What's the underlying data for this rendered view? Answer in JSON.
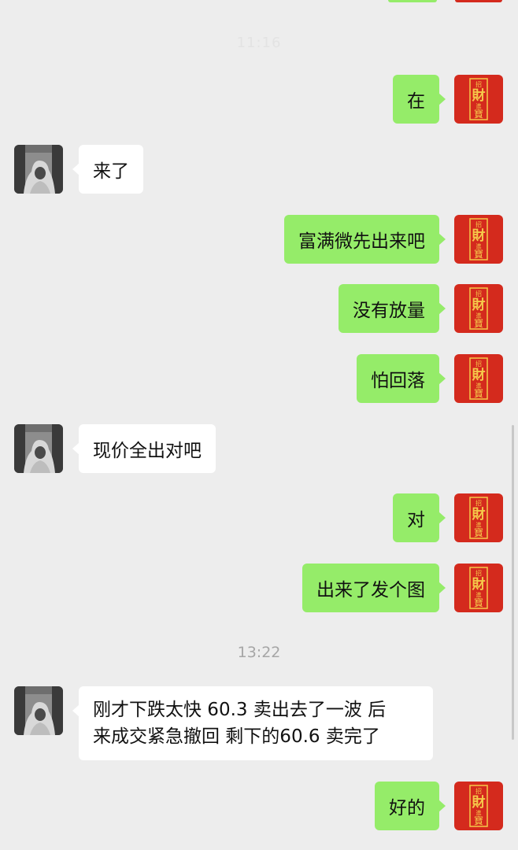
{
  "top_partial": {
    "faded_time": "11:16"
  },
  "divider": {
    "time": "13:22"
  },
  "colors": {
    "background": "#ededed",
    "outgoing_bubble": "#95ec69",
    "incoming_bubble": "#ffffff",
    "my_avatar_red": "#d42a1d",
    "my_avatar_gold": "#f5c94a"
  },
  "avatars": {
    "me_glyphs": [
      "招",
      "財",
      "進",
      "寶"
    ],
    "them_icon": "hooded-figure-icon"
  },
  "messages": [
    {
      "sender": "me",
      "text": "在"
    },
    {
      "sender": "them",
      "text": "来了"
    },
    {
      "sender": "me",
      "text": "富满微先出来吧"
    },
    {
      "sender": "me",
      "text": "没有放量"
    },
    {
      "sender": "me",
      "text": "怕回落"
    },
    {
      "sender": "them",
      "text": "现价全出对吧"
    },
    {
      "sender": "me",
      "text": "对"
    },
    {
      "sender": "me",
      "text": "出来了发个图"
    },
    {
      "sender": "them",
      "lines": [
        "刚才下跌太快 60.3 卖出去了一波  后",
        "来成交紧急撤回  剩下的60.6 卖完了"
      ]
    },
    {
      "sender": "me",
      "text": "好的"
    }
  ]
}
